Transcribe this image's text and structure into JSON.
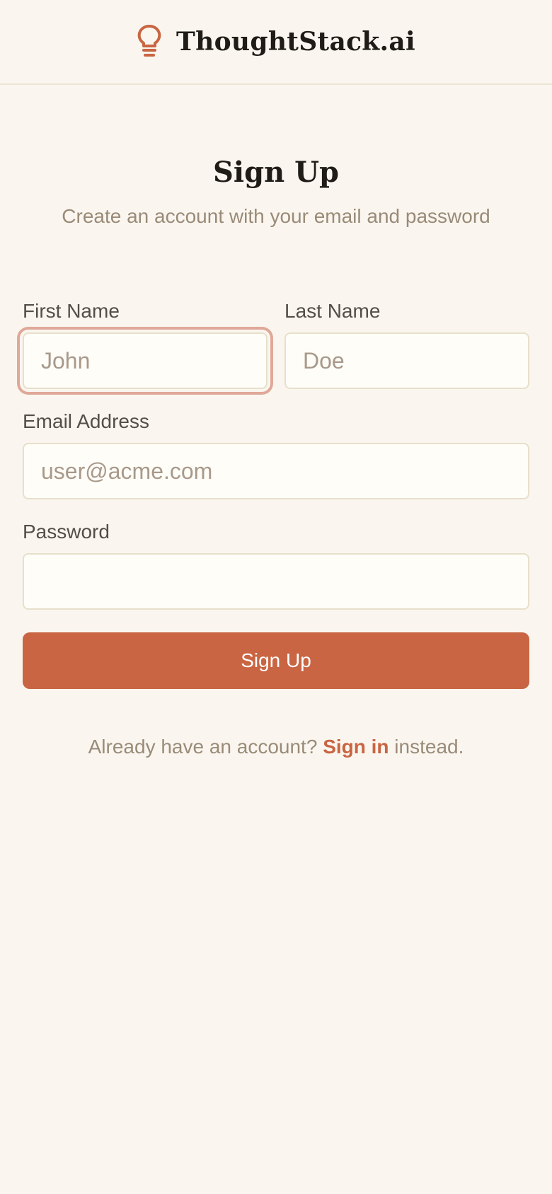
{
  "header": {
    "brand_name": "ThoughtStack.ai",
    "logo_icon": "lightbulb-icon",
    "accent_color": "#c96542"
  },
  "page": {
    "title": "Sign Up",
    "subtitle": "Create an account with your email and password"
  },
  "form": {
    "first_name": {
      "label": "First Name",
      "placeholder": "John",
      "value": ""
    },
    "last_name": {
      "label": "Last Name",
      "placeholder": "Doe",
      "value": ""
    },
    "email": {
      "label": "Email Address",
      "placeholder": "user@acme.com",
      "value": ""
    },
    "password": {
      "label": "Password",
      "placeholder": "",
      "value": ""
    },
    "submit_label": "Sign Up"
  },
  "footer": {
    "prompt": "Already have an account?",
    "link_label": "Sign in",
    "suffix": "instead."
  }
}
